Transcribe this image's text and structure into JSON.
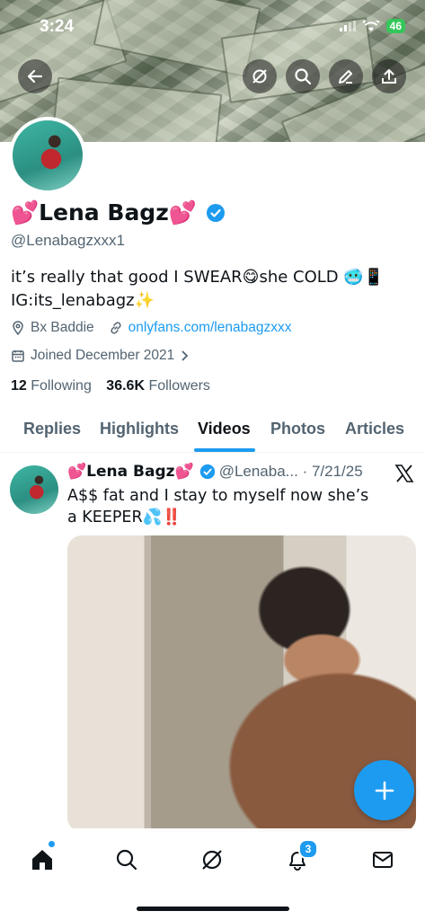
{
  "status_bar": {
    "time": "3:24",
    "battery": "46"
  },
  "profile": {
    "name": "💕Lena Bagz💕",
    "handle": "@Lenabagzxxx1",
    "bio_line1": "it’s really that good I SWEAR😋she COLD 🥶📱",
    "bio_line2": "IG:its_lenabagz✨",
    "location": "Bx Baddie",
    "website": "onlyfans.com/lenabagzxxx",
    "joined": "Joined December 2021",
    "following_count": "12",
    "following_label": "Following",
    "followers_count": "36.6K",
    "followers_label": "Followers"
  },
  "tabs": [
    {
      "label": "Replies"
    },
    {
      "label": "Highlights"
    },
    {
      "label": "Videos"
    },
    {
      "label": "Photos"
    },
    {
      "label": "Articles"
    }
  ],
  "post": {
    "author": "💕Lena Bagz💕",
    "handle_date": "@Lenaba... · 7/21/25",
    "text": "A$$ fat and I stay to myself now she’s a KEEPER💦‼️"
  },
  "nav": {
    "notifications_badge": "3"
  },
  "colors": {
    "accent": "#1d9bf0",
    "text": "#0f1419",
    "muted": "#536471"
  },
  "icons": [
    "back-arrow-icon",
    "grok-icon",
    "search-icon",
    "edit-icon",
    "share-icon",
    "verified-icon",
    "location-icon",
    "link-icon",
    "calendar-icon",
    "x-logo-icon",
    "plus-icon",
    "home-icon",
    "notifications-icon",
    "mail-icon"
  ]
}
